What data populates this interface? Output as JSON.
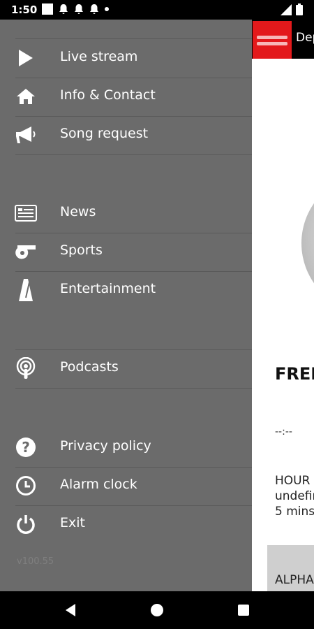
{
  "status_bar": {
    "time": "1:50"
  },
  "topbar": {
    "title": "Dep"
  },
  "main": {
    "song_title": "FREE",
    "time_display": "--:--",
    "info_lines": [
      "HOUR",
      "undefin",
      "5 mins"
    ],
    "card_text": "ALPHA"
  },
  "drawer": {
    "items": [
      {
        "label": "Live stream",
        "icon": "play-icon"
      },
      {
        "label": "Info & Contact",
        "icon": "home-icon"
      },
      {
        "label": "Song request",
        "icon": "megaphone-icon"
      },
      {
        "label": "News",
        "icon": "news-icon"
      },
      {
        "label": "Sports",
        "icon": "whistle-icon"
      },
      {
        "label": "Entertainment",
        "icon": "metronome-icon"
      },
      {
        "label": "Podcasts",
        "icon": "podcast-icon"
      },
      {
        "label": "Privacy policy",
        "icon": "help-icon"
      },
      {
        "label": "Alarm clock",
        "icon": "clock-icon"
      },
      {
        "label": "Exit",
        "icon": "power-icon"
      }
    ],
    "version": "v100.55"
  },
  "colors": {
    "accent": "#e3191b",
    "drawer_bg": "#6b6b6b",
    "topbar_bg": "#000000"
  }
}
